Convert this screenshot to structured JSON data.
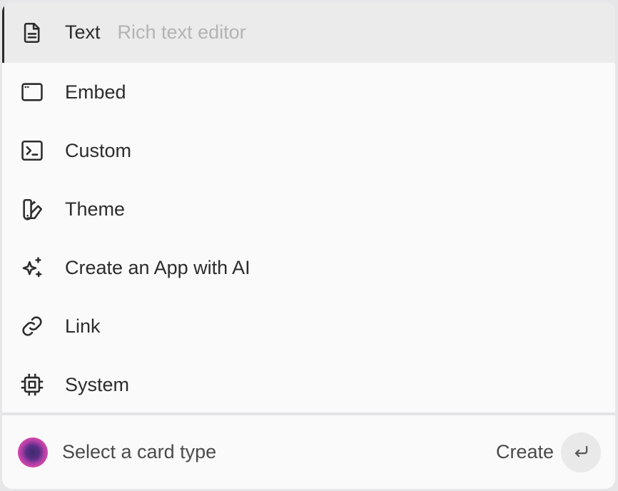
{
  "menu": {
    "items": [
      {
        "label": "Text",
        "hint": "Rich text editor",
        "icon": "document-icon",
        "active": true
      },
      {
        "label": "Embed",
        "icon": "browser-window-icon"
      },
      {
        "label": "Custom",
        "icon": "terminal-icon"
      },
      {
        "label": "Theme",
        "icon": "palette-swatch-icon"
      },
      {
        "label": "Create an App with AI",
        "icon": "sparkles-icon"
      },
      {
        "label": "Link",
        "icon": "link-icon"
      },
      {
        "label": "System",
        "icon": "cpu-chip-icon"
      }
    ]
  },
  "footer": {
    "prompt": "Select a card type",
    "create_label": "Create",
    "enter_icon": "enter-key-icon"
  },
  "colors": {
    "active_bg": "#ebebeb",
    "panel_bg": "#fafafa",
    "hint_text": "#b3b3b3",
    "orb_outer": "#e24aa8",
    "orb_inner": "#3d2a6e"
  }
}
